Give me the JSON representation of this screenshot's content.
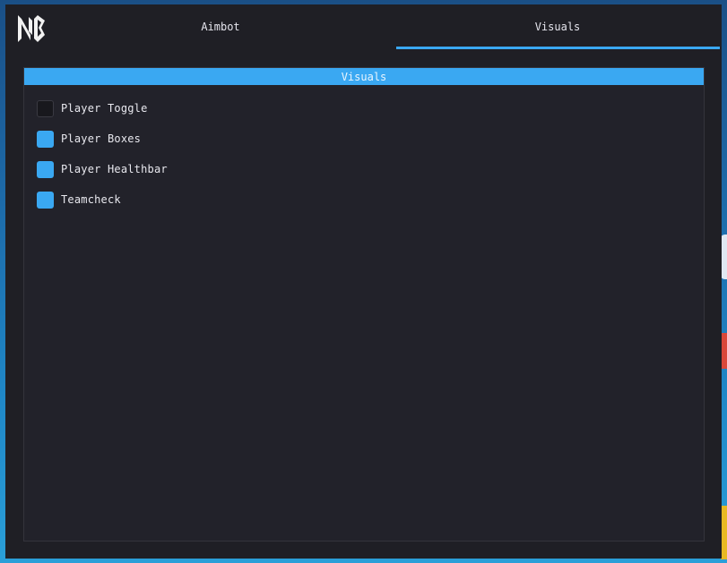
{
  "header": {
    "logo_icon": "nb-logo-icon",
    "tabs": [
      {
        "label": "Aimbot",
        "active": false
      },
      {
        "label": "Visuals",
        "active": true
      }
    ]
  },
  "panel": {
    "title": "Visuals",
    "options": [
      {
        "label": "Player Toggle",
        "checked": false
      },
      {
        "label": "Player Boxes",
        "checked": true
      },
      {
        "label": "Player Healthbar",
        "checked": true
      },
      {
        "label": "Teamcheck",
        "checked": true
      }
    ]
  },
  "colors": {
    "accent": "#3aa8f2",
    "window_bg": "#1f1f25",
    "panel_bg": "#22222a"
  }
}
